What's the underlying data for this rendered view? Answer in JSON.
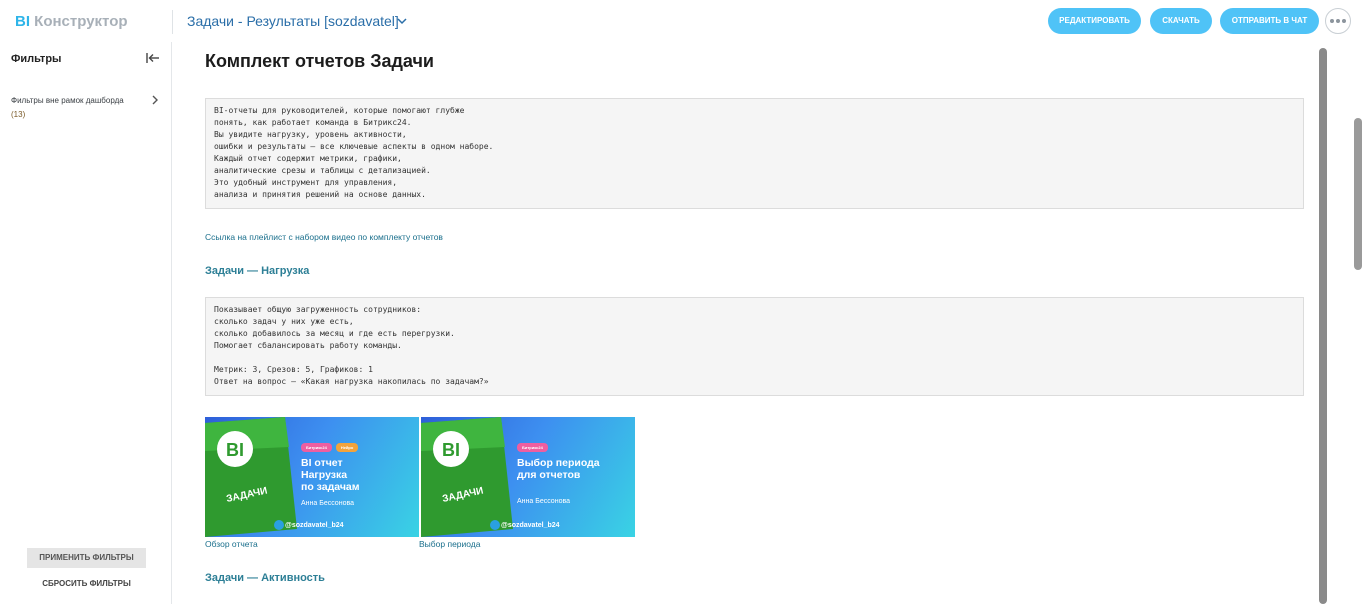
{
  "app": {
    "logo_bi": "BI",
    "logo_rest": "Конструктор"
  },
  "header": {
    "dashboard_title": "Задачи - Результаты [sozdavatel]",
    "buttons": {
      "edit": "РЕДАКТИРОВАТЬ",
      "download": "СКАЧАТЬ",
      "send": "ОТПРАВИТЬ В ЧАТ"
    }
  },
  "sidebar": {
    "title": "Фильтры",
    "external_filters": "Фильтры вне рамок дашборда",
    "external_count": "(13)",
    "apply": "ПРИМЕНИТЬ ФИЛЬТРЫ",
    "reset": "СБРОСИТЬ ФИЛЬТРЫ"
  },
  "content": {
    "title": "Комплект отчетов Задачи",
    "intro": "BI-отчеты для руководителей, которые помогают глубже\nпонять, как работает команда в Битрикс24.\nВы увидите нагрузку, уровень активности,\nошибки и результаты — все ключевые аспекты в одном наборе.\nКаждый отчет содержит метрики, графики,\nаналитические срезы и таблицы с детализацией.\nЭто удобный инструмент для управления,\nанализа и принятия решений на основе данных.",
    "playlist_link": "Ссылка на плейлист с набором видео по комплекту отчетов",
    "section1_title": "Задачи — Нагрузка",
    "section1_text": "Показывает общую загруженность сотрудников:\nсколько задач у них уже есть,\nсколько добавилось за месяц и где есть перегрузки.\nПомогает сбалансировать работу команды.\n\nМетрик: 3, Срезов: 5, Графиков: 1\nОтвет на вопрос – «Какая нагрузка накопилась по задачам?»",
    "videos": [
      {
        "caption": "Обзор отчета",
        "tags": [
          "Битрикс24",
          "Нейро"
        ],
        "title": "BI отчет\nНагрузка\nпо задачам",
        "author": "Анна Бессонова",
        "telegram": "@sozdavatel_b24",
        "badge": "BI",
        "box_label": "ЗАДАЧИ"
      },
      {
        "caption": "Выбор периода",
        "tags": [
          "Битрикс24"
        ],
        "title": "Выбор периода\nдля отчетов",
        "author": "Анна Бессонова",
        "telegram": "@sozdavatel_b24",
        "badge": "BI",
        "box_label": "ЗАДАЧИ"
      }
    ],
    "section2_title": "Задачи — Активность"
  },
  "colors": {
    "accent": "#4fc3f7",
    "link": "#1a6f8c",
    "section": "#2d7f96"
  }
}
